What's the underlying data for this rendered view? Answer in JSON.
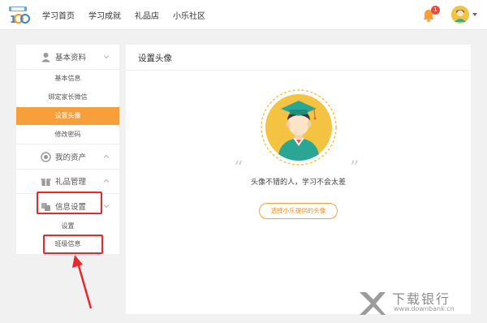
{
  "nav": {
    "items": [
      "学习首页",
      "学习成就",
      "礼品店",
      "小乐社区"
    ],
    "notification_count": "1"
  },
  "sidebar": {
    "sections": [
      {
        "label": "基本资料",
        "items": [
          "基本信息",
          "绑定家长微信",
          "设置头像",
          "修改密码"
        ]
      },
      {
        "label": "我的资产"
      },
      {
        "label": "礼品管理"
      },
      {
        "label": "信息设置",
        "items": [
          "设置",
          "班级信息"
        ]
      }
    ],
    "active_item": "设置头像"
  },
  "main": {
    "title": "设置头像",
    "slogan": "头像不错的人，学习不会太差",
    "choose_button": "选择小乐提供的头像"
  },
  "watermark": {
    "name": "下载银行",
    "url": "www.downbank.cn"
  },
  "colors": {
    "accent": "#f7a03b",
    "highlight_box": "#e8282b",
    "badge": "#f0483e"
  }
}
